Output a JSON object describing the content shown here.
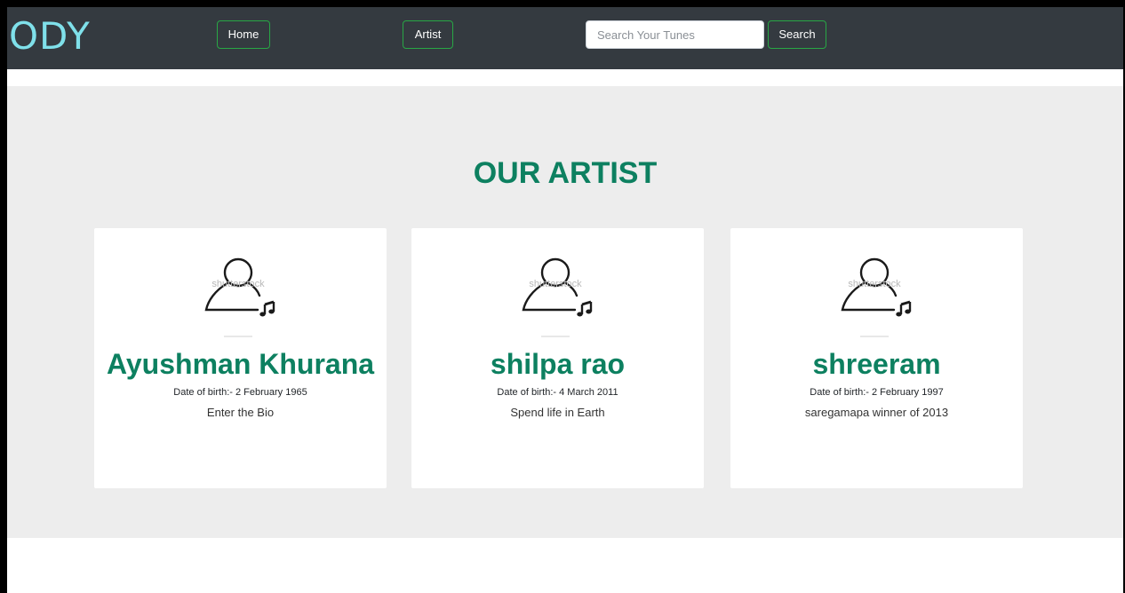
{
  "navbar": {
    "brand": "ODY",
    "home_label": "Home",
    "artist_label": "Artist",
    "search_placeholder": "Search Your Tunes",
    "search_label": "Search"
  },
  "section": {
    "title": "OUR ARTIST"
  },
  "artists": [
    {
      "name": "Ayushman Khurana",
      "dob": "Date of birth:- 2 February 1965",
      "bio": "Enter the Bio",
      "image_icon": "person-music-icon",
      "watermark": "shutterstock"
    },
    {
      "name": "shilpa rao",
      "dob": "Date of birth:- 4 March 2011",
      "bio": "Spend life in Earth",
      "image_icon": "person-music-icon",
      "watermark": "shutterstock"
    },
    {
      "name": "shreeram",
      "dob": "Date of birth:- 2 February 1997",
      "bio": "saregamapa winner of 2013",
      "image_icon": "person-music-icon",
      "watermark": "shutterstock"
    }
  ],
  "colors": {
    "navbar_bg": "#343a40",
    "brand": "#7fe0ea",
    "accent_green": "#0d8060",
    "button_border": "#28a745",
    "section_bg": "#ededed"
  }
}
